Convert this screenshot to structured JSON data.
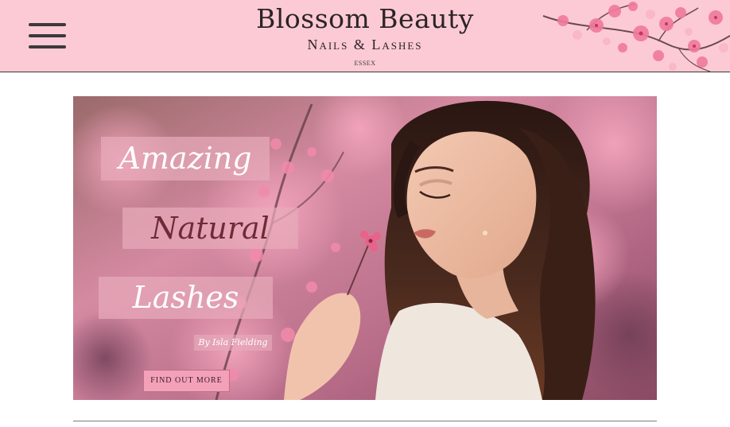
{
  "header": {
    "menu_icon": "hamburger-menu-icon",
    "brand_title": "Blossom Beauty",
    "brand_subtitle": "Nails & Lashes",
    "brand_location": "ESSEX",
    "decoration_icon": "cherry-blossom-branch-icon",
    "background_color": "#fccad5"
  },
  "hero": {
    "line1": "Amazing",
    "line2": "Natural",
    "line3": "Lashes",
    "byline": "By Isla Fielding",
    "cta_label": "FIND OUT MORE",
    "accent_color": "#f3a1b8"
  }
}
